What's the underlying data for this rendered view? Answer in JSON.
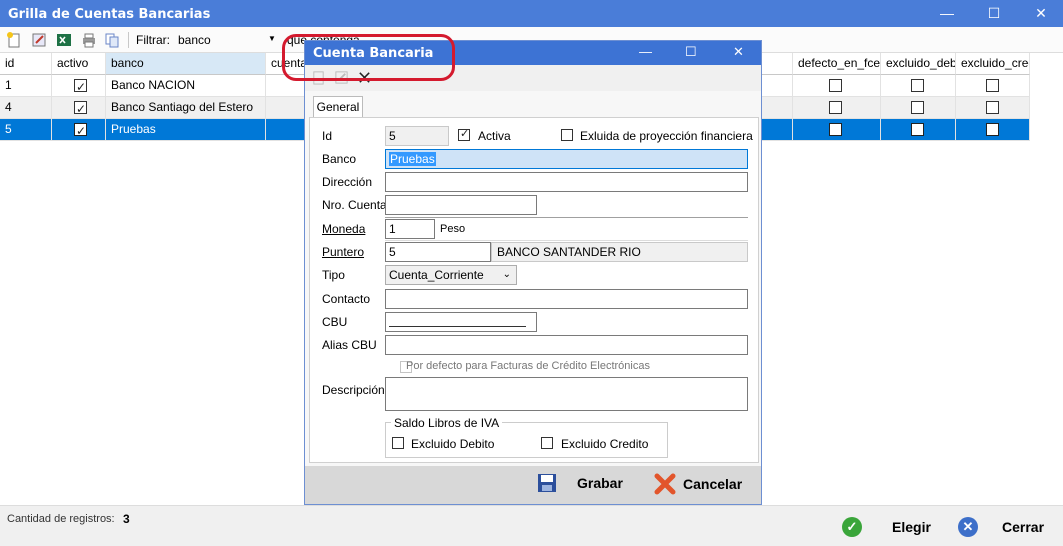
{
  "main": {
    "title": "Grilla de Cuentas Bancarias",
    "window_controls": {
      "minimize": "—",
      "maximize": "☐",
      "close": "✕"
    }
  },
  "toolbar": {
    "filter_label": "Filtrar:",
    "filter_value": "banco",
    "contains_label": "que contenga"
  },
  "grid": {
    "columns": [
      "id",
      "activo",
      "banco",
      "cuenta",
      "defecto_en_fce",
      "excluido_debito",
      "excluido_credito"
    ],
    "rows": [
      {
        "id": "1",
        "activo": true,
        "banco": "Banco NACION"
      },
      {
        "id": "4",
        "activo": true,
        "banco": "Banco Santiago del Estero"
      },
      {
        "id": "5",
        "activo": true,
        "banco": "Pruebas"
      }
    ]
  },
  "status": {
    "count_label": "Cantidad de registros:",
    "count_value": "3",
    "elegir": "Elegir",
    "cerrar": "Cerrar"
  },
  "dialog": {
    "title": "Cuenta Bancaria",
    "tab": "General",
    "fields": {
      "id_label": "Id",
      "id_value": "5",
      "activa_label": "Activa",
      "excluida_label": "Exluida de proyección financiera",
      "banco_label": "Banco",
      "banco_value": "Pruebas",
      "direccion_label": "Dirección",
      "direccion_value": "",
      "nro_cuenta_label": "Nro. Cuenta",
      "nro_cuenta_value": "",
      "moneda_label": "Moneda",
      "moneda_value": "1",
      "moneda_name": "Peso",
      "puntero_label": "Puntero",
      "puntero_value": "5",
      "puntero_name": "BANCO SANTANDER RIO",
      "tipo_label": "Tipo",
      "tipo_value": "Cuenta_Corriente",
      "contacto_label": "Contacto",
      "contacto_value": "",
      "cbu_label": "CBU",
      "cbu_value": "",
      "alias_label": "Alias CBU",
      "alias_value": "",
      "defecto_fce_label": "Por defecto para Facturas de Crédito Electrónicas",
      "descripcion_label": "Descripción",
      "descripcion_value": "",
      "iva_group_title": "Saldo Libros de IVA",
      "excluido_debito_label": "Excluido Debito",
      "excluido_credito_label": "Excluido Credito"
    },
    "footer": {
      "grabar": "Grabar",
      "cancelar": "Cancelar"
    }
  },
  "colors": {
    "title_bar": "#4a7dd8",
    "selected_row": "#0078d7",
    "highlight_circle": "#d41a2e"
  }
}
